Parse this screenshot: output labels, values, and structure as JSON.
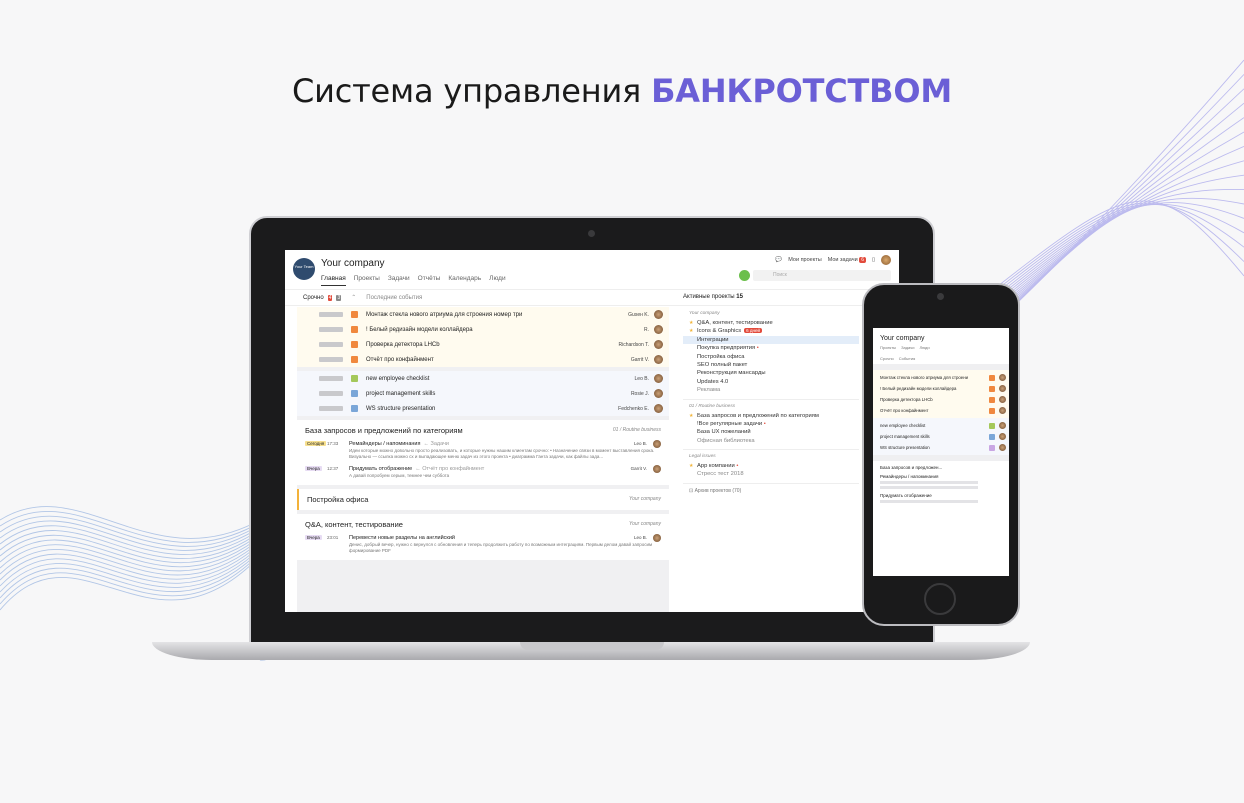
{
  "headline": {
    "text": "Система управления",
    "accent": "БАНКРОТСТВОМ"
  },
  "colors": {
    "accent": "#6b5fd6",
    "urgent": "#e24a3b",
    "warning": "#f3b23a",
    "info": "#7aa6d8",
    "ok": "#6bbf4b"
  },
  "app": {
    "company": "Your company",
    "logo_text": "Your Team",
    "nav": [
      "Главная",
      "Проекты",
      "Задачи",
      "Отчёты",
      "Календарь",
      "Люди"
    ],
    "my_projects": "Мои проекты",
    "my_tasks": "Мои задачи",
    "my_tasks_count": "6",
    "search_placeholder": "Поиск",
    "urgent_label": "Срочно",
    "urgent_count_a": "4",
    "urgent_count_b": "3",
    "recent_events": "Последние события",
    "active_projects_label": "Активные проекты",
    "active_projects_count": "15"
  },
  "urgent_tasks": [
    {
      "text": "Монтаж стекла нового атриума для строения номер три",
      "who": "Guseн K.",
      "prio": "#f0883e"
    },
    {
      "text": "! Белый редизайн модели коллайдера",
      "who": "R.",
      "prio": "#f0883e"
    },
    {
      "text": "Проверка детектора LHCb",
      "who": "Richardson T.",
      "prio": "#f0883e"
    },
    {
      "text": "Отчёт про конфайнмент",
      "who": "Garrit V.",
      "prio": "#f0883e"
    }
  ],
  "info_tasks": [
    {
      "text": "new employee checklist",
      "who": "Leo B.",
      "prio": "#a4c85a"
    },
    {
      "text": "project management skills",
      "who": "Rosie J.",
      "prio": "#7aa6d8"
    },
    {
      "text": "WS structure presentation",
      "who": "Fedchenko E.",
      "prio": "#7aa6d8"
    }
  ],
  "cards": [
    {
      "title": "База запросов и предложений по категориям",
      "tag": "01 / Routine business",
      "messages": [
        {
          "day": "Сегодня",
          "time": "17:33",
          "title": "Ремайндеры / напоминания",
          "crumb": "← Задачи",
          "who": "Leo B.",
          "body": "Идеи которые можно довольно просто реализовать, и которые нужны нашим клиентам срочно: • Назначение связи в момент выставления срока. Визуально — ссылка можно сх и выпадающее меню задач из этого проекта • диаграмма Ганта задачи, как файлы зада..."
        },
        {
          "day": "Вчера",
          "time": "12:37",
          "title": "Придумать отображение",
          "crumb": "← Отчёт про конфайнмент",
          "who": "Garrit V.",
          "body": "А давай попробуем серым, темнее чем суббота"
        }
      ]
    },
    {
      "title": "Постройка офиса",
      "tag": "Your company",
      "messages": []
    },
    {
      "title": "Q&A, контент, тестирование",
      "tag": "Your company",
      "messages": [
        {
          "day": "Вчера",
          "time": "23:01",
          "title": "Перевести новые разделы на английский",
          "crumb": "",
          "who": "Leo B.",
          "body": "Денис, добрый вечер, нужно с вернулся с обновления и теперь продолжить работу по возможным интеграциям. Первым делом давай запросим формирование PDF"
        }
      ]
    }
  ],
  "projects": {
    "section1_head": "Your company",
    "section1": [
      {
        "label": "Q&A, контент, тестирование",
        "star": true
      },
      {
        "label": "Icons & Graphics",
        "star": true,
        "badge": "6 дней"
      },
      {
        "label": "Интеграции",
        "selected": true
      },
      {
        "label": "Покупка предприятия",
        "dot": true
      },
      {
        "label": "Постройка офиса"
      },
      {
        "label": "SEO полный пакет"
      },
      {
        "label": "Реконструкция мансарды"
      },
      {
        "label": "Updates 4.0"
      },
      {
        "label": "Реклама",
        "muted": true
      }
    ],
    "section2_head": "01 / Routine business",
    "section2": [
      {
        "label": "База запросов и предложений по категориям",
        "star": true
      },
      {
        "label": "!Все регулярные задачи",
        "dot": true
      },
      {
        "label": "База UX пожеланий"
      },
      {
        "label": "Офисная библиотека",
        "muted": true
      }
    ],
    "section3_head": "Legal issues",
    "section3": [
      {
        "label": "App компании",
        "star": true,
        "dot": true
      },
      {
        "label": "Стресс тест 2018",
        "muted": true
      }
    ],
    "archive": "Архив проектов (70)"
  },
  "phone": {
    "company": "Your company",
    "nav": [
      "Проекты",
      "Задачи",
      "Люди"
    ],
    "urgent": "Срочно",
    "events": "События",
    "rows_warn": [
      "Монтаж стекла нового атриума для строени",
      "! Белый редизайн модели коллайдера",
      "Проверка детектора LHCb",
      "Отчёт про конфайнмент"
    ],
    "rows_info": [
      "new employee checklist",
      "project management skills",
      "WS structure presentation"
    ],
    "card_title": "База запросов и предложен...",
    "msg1": "Ремайндеры / напоминания",
    "msg2": "Придумать отображение"
  }
}
